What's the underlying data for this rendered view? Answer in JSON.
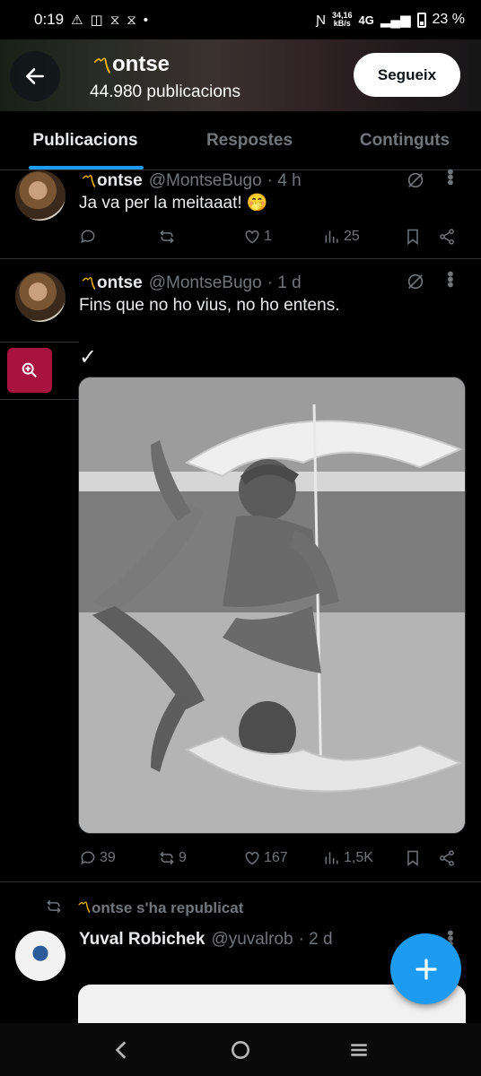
{
  "status_bar": {
    "time": "0:19",
    "net_speed_value": "34,16",
    "net_speed_unit": "kB/s",
    "network": "4G",
    "battery": "23 %"
  },
  "header": {
    "back_icon": "arrow-left-icon",
    "name": "ontse",
    "post_count": "44.980 publicacions",
    "follow_label": "Segueix"
  },
  "tabs": [
    {
      "label": "Publicacions",
      "active": true
    },
    {
      "label": "Respostes",
      "active": false
    },
    {
      "label": "Continguts",
      "active": false
    }
  ],
  "posts": [
    {
      "name": "ontse",
      "handle": "@MontseBugo",
      "time": "· 4 h",
      "text": "Ja va per la meitaaat! 🤭",
      "replies": "",
      "reposts": "",
      "likes": "1",
      "views": "25"
    },
    {
      "name": "ontse",
      "handle": "@MontseBugo",
      "time": "· 1 d",
      "text": "Fins que no ho vius, no ho entens.",
      "checkmark": "✓",
      "replies": "39",
      "reposts": "9",
      "likes": "167",
      "views": "1,5K"
    },
    {
      "repost_label": "ontse s'ha republicat",
      "name": "Yuval Robichek",
      "handle": "@yuvalrob",
      "time": "· 2 d"
    }
  ],
  "colors": {
    "accent": "#1d9bf0",
    "background": "#000000",
    "muted": "#71767b",
    "zoom_button": "#a8123f",
    "logo": "#f5b400"
  }
}
